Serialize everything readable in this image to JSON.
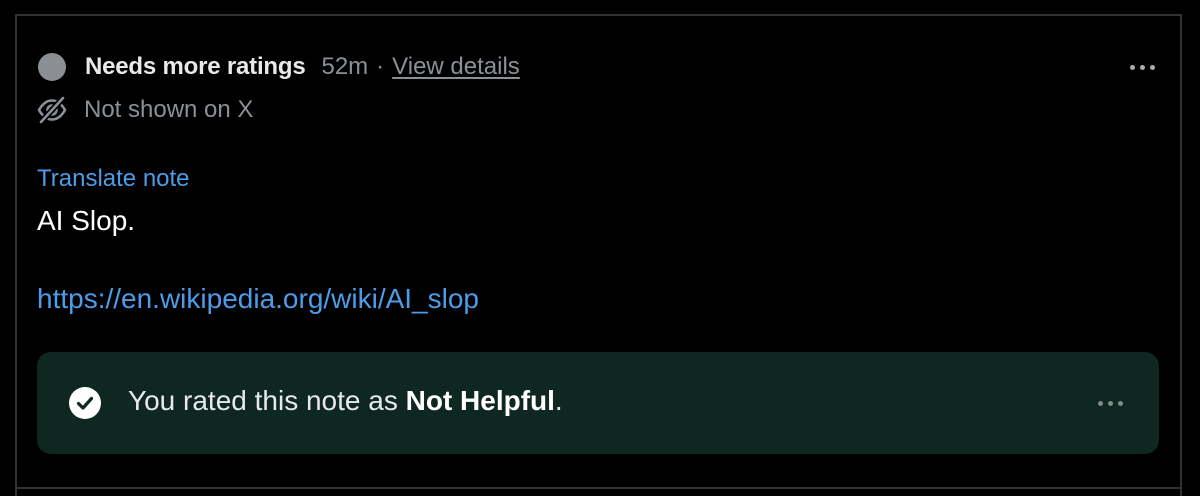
{
  "status": {
    "title": "Needs more ratings",
    "time": "52m",
    "separator": "·",
    "details_link": "View details"
  },
  "visibility": {
    "text": "Not shown on X",
    "icon": "eye-slash-icon"
  },
  "note": {
    "translate_label": "Translate note",
    "body": "AI Slop.",
    "url": "https://en.wikipedia.org/wiki/AI_slop"
  },
  "rating": {
    "prefix": "You rated this note as ",
    "value": "Not Helpful",
    "suffix": ".",
    "icon": "check-circle-icon"
  },
  "colors": {
    "background": "#000000",
    "link": "#4b9ce9",
    "muted": "#8b9096",
    "banner": "#0e2720"
  }
}
